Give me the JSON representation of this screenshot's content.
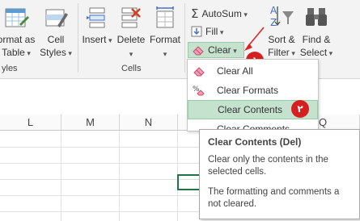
{
  "ribbon": {
    "format_as_table": {
      "line1": "ormat as",
      "line2": "Table"
    },
    "cell_styles": {
      "line1": "Cell",
      "line2": "Styles"
    },
    "insert": "Insert",
    "delete": "Delete",
    "format": "Format",
    "autosum": "AutoSum",
    "fill": "Fill",
    "clear": "Clear",
    "sort_filter": {
      "line1": "Sort &",
      "line2": "Filter"
    },
    "find_select": {
      "line1": "Find &",
      "line2": "Select"
    },
    "styles_group_label": "yles",
    "cells_group_label": "Cells"
  },
  "markers": {
    "first": "١",
    "second": "٢"
  },
  "menu": {
    "items": [
      {
        "label": "Clear All",
        "icon": "eraser-icon",
        "highlighted": false
      },
      {
        "label": "Clear Formats",
        "icon": "percent-eraser-icon",
        "highlighted": false
      },
      {
        "label": "Clear Contents",
        "icon": "none",
        "highlighted": true
      },
      {
        "label": "Clear Comments",
        "icon": "none",
        "highlighted": false
      }
    ]
  },
  "tooltip": {
    "title": "Clear Contents (Del)",
    "text1": "Clear only the contents in the selected cells.",
    "text2": "The formatting and comments a not cleared."
  },
  "grid": {
    "columns": [
      "L",
      "M",
      "N",
      "",
      "Q"
    ]
  },
  "colors": {
    "highlight": "#c5e2cf",
    "marker": "#d61f1f",
    "arrow": "#e02020"
  }
}
